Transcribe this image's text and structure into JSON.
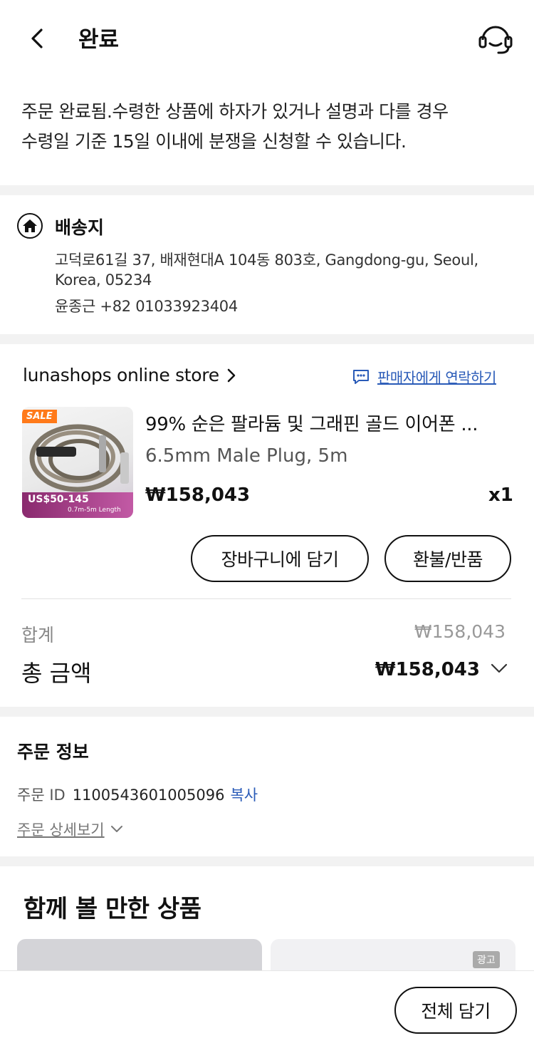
{
  "header": {
    "title": "완료"
  },
  "notice": {
    "line1": "주문 완료됨.수령한 상품에 하자가 있거나 설명과 다를 경우",
    "line2": "수령일 기준 15일 이내에 분쟁을 신청할 수 있습니다."
  },
  "shipping": {
    "title": "배송지",
    "address_line1": "고덕로61길 37, 배재현대A 104동 803호, Gangdong-gu, Seoul,",
    "address_line2": "Korea, 05234",
    "recipient": "윤종근 +82 01033923404"
  },
  "store": {
    "name": "lunashops online store",
    "contact_label": "판매자에게 연락하기"
  },
  "product": {
    "thumb_sale": "SALE",
    "thumb_price": "US$50-145",
    "thumb_length": "0.7m-5m Length",
    "title": "99% 순은 팔라듐 및 그래핀 골드 이어폰 ...",
    "option": "6.5mm Male Plug, 5m",
    "price": "₩158,043",
    "quantity": "x1"
  },
  "actions": {
    "add_to_cart": "장바구니에 담기",
    "refund": "환불/반품"
  },
  "summary": {
    "subtotal_label": "합계",
    "subtotal_value": "₩158,043",
    "total_label": "총 금액",
    "total_value": "₩158,043"
  },
  "order_info": {
    "title": "주문 정보",
    "id_label": "주문 ID",
    "id_value": "1100543601005096",
    "copy_label": "복사",
    "detail_label": "주문 상세보기"
  },
  "recommend": {
    "title": "함께 볼 만한 상품",
    "ad_label": "광고"
  },
  "bottom": {
    "add_all_label": "전체 담기"
  },
  "colors": {
    "link": "#2a5bb8",
    "sale": "#ff7a1a",
    "section_gap": "#f2f2f2"
  }
}
